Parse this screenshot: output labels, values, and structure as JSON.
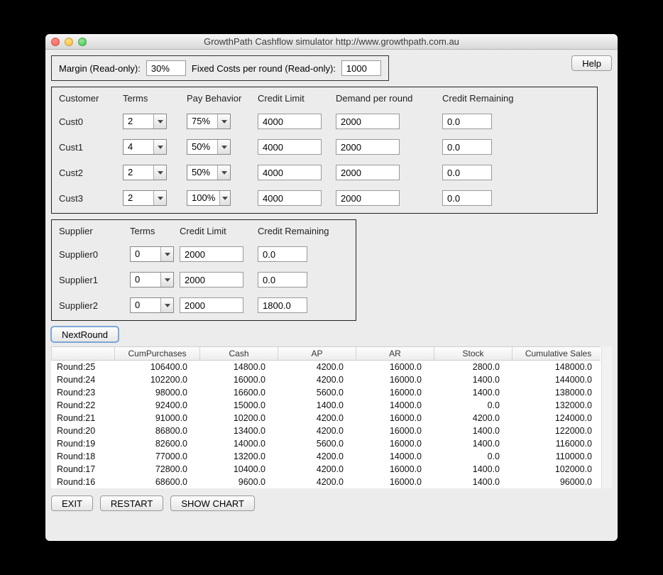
{
  "window": {
    "title": "GrowthPath Cashflow simulator http://www.growthpath.com.au"
  },
  "topbar": {
    "margin_label": "Margin (Read-only):",
    "margin_value": "30%",
    "fixed_label": "Fixed Costs per round (Read-only):",
    "fixed_value": "1000",
    "help_label": "Help"
  },
  "customer_panel": {
    "headers": {
      "customer": "Customer",
      "terms": "Terms",
      "pay": "Pay Behavior",
      "credit_limit": "Credit Limit",
      "demand": "Demand per round",
      "credit_remaining": "Credit Remaining"
    },
    "rows": [
      {
        "name": "Cust0",
        "terms": "2",
        "pay": "75%",
        "credit_limit": "4000",
        "demand": "2000",
        "credit_remaining": "0.0"
      },
      {
        "name": "Cust1",
        "terms": "4",
        "pay": "50%",
        "credit_limit": "4000",
        "demand": "2000",
        "credit_remaining": "0.0"
      },
      {
        "name": "Cust2",
        "terms": "2",
        "pay": "50%",
        "credit_limit": "4000",
        "demand": "2000",
        "credit_remaining": "0.0"
      },
      {
        "name": "Cust3",
        "terms": "2",
        "pay": "100%",
        "credit_limit": "4000",
        "demand": "2000",
        "credit_remaining": "0.0"
      }
    ]
  },
  "supplier_panel": {
    "headers": {
      "supplier": "Supplier",
      "terms": "Terms",
      "credit_limit": "Credit Limit",
      "credit_remaining": "Credit Remaining"
    },
    "rows": [
      {
        "name": "Supplier0",
        "terms": "0",
        "credit_limit": "2000",
        "credit_remaining": "0.0"
      },
      {
        "name": "Supplier1",
        "terms": "0",
        "credit_limit": "2000",
        "credit_remaining": "0.0"
      },
      {
        "name": "Supplier2",
        "terms": "0",
        "credit_limit": "2000",
        "credit_remaining": "1800.0"
      }
    ]
  },
  "next_round_label": "NextRound",
  "table": {
    "headers": {
      "round": "",
      "cum_purchases": "CumPurchases",
      "cash": "Cash",
      "ap": "AP",
      "ar": "AR",
      "stock": "Stock",
      "cum_sales": "Cumulative Sales"
    },
    "rows": [
      {
        "round": "Round:25",
        "cum_purchases": "106400.0",
        "cash": "14800.0",
        "ap": "4200.0",
        "ar": "16000.0",
        "stock": "2800.0",
        "cum_sales": "148000.0"
      },
      {
        "round": "Round:24",
        "cum_purchases": "102200.0",
        "cash": "16000.0",
        "ap": "4200.0",
        "ar": "16000.0",
        "stock": "1400.0",
        "cum_sales": "144000.0"
      },
      {
        "round": "Round:23",
        "cum_purchases": "98000.0",
        "cash": "16600.0",
        "ap": "5600.0",
        "ar": "16000.0",
        "stock": "1400.0",
        "cum_sales": "138000.0"
      },
      {
        "round": "Round:22",
        "cum_purchases": "92400.0",
        "cash": "15000.0",
        "ap": "1400.0",
        "ar": "14000.0",
        "stock": "0.0",
        "cum_sales": "132000.0"
      },
      {
        "round": "Round:21",
        "cum_purchases": "91000.0",
        "cash": "10200.0",
        "ap": "4200.0",
        "ar": "16000.0",
        "stock": "4200.0",
        "cum_sales": "124000.0"
      },
      {
        "round": "Round:20",
        "cum_purchases": "86800.0",
        "cash": "13400.0",
        "ap": "4200.0",
        "ar": "16000.0",
        "stock": "1400.0",
        "cum_sales": "122000.0"
      },
      {
        "round": "Round:19",
        "cum_purchases": "82600.0",
        "cash": "14000.0",
        "ap": "5600.0",
        "ar": "16000.0",
        "stock": "1400.0",
        "cum_sales": "116000.0"
      },
      {
        "round": "Round:18",
        "cum_purchases": "77000.0",
        "cash": "13200.0",
        "ap": "4200.0",
        "ar": "14000.0",
        "stock": "0.0",
        "cum_sales": "110000.0"
      },
      {
        "round": "Round:17",
        "cum_purchases": "72800.0",
        "cash": "10400.0",
        "ap": "4200.0",
        "ar": "16000.0",
        "stock": "1400.0",
        "cum_sales": "102000.0"
      },
      {
        "round": "Round:16",
        "cum_purchases": "68600.0",
        "cash": "9600.0",
        "ap": "4200.0",
        "ar": "16000.0",
        "stock": "1400.0",
        "cum_sales": "96000.0"
      }
    ]
  },
  "bottom": {
    "exit": "EXIT",
    "restart": "RESTART",
    "show_chart": "SHOW CHART"
  }
}
